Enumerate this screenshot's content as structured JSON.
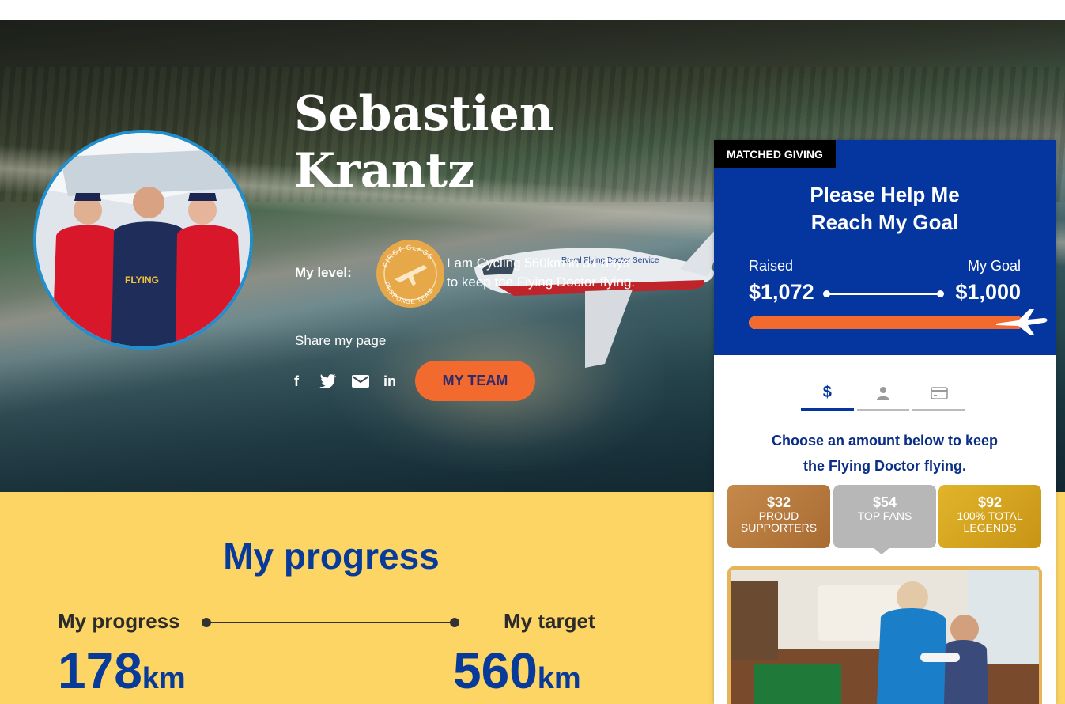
{
  "profile": {
    "first_name": "Sebastien",
    "last_name": "Krantz",
    "level_label": "My level:",
    "badge_text_top": "FIRST CLASS",
    "badge_text_bottom": "RESPONSE TEAM",
    "level_line1": "I am Cycling 560km in 31 days",
    "level_line2": "to keep the Flying Doctor flying.",
    "share_label": "Share my page",
    "team_button": "MY TEAM",
    "avatar_shirt_text": "FLYING"
  },
  "social": [
    {
      "icon": "facebook-icon",
      "glyph": "f"
    },
    {
      "icon": "twitter-icon",
      "glyph": "🐦"
    },
    {
      "icon": "email-icon",
      "glyph": "✉"
    },
    {
      "icon": "linkedin-icon",
      "glyph": "in"
    }
  ],
  "plane_livery": "Royal Flying Doctor Service",
  "progress": {
    "title": "My progress",
    "left_label": "My progress",
    "right_label": "My target",
    "current_value": "178",
    "target_value": "560",
    "unit": "km"
  },
  "donate": {
    "matched_tag": "MATCHED GIVING",
    "title_line1": "Please Help Me",
    "title_line2": "Reach My Goal",
    "raised_label": "Raised",
    "goal_label": "My Goal",
    "raised_value": "$1,072",
    "goal_value": "$1,000",
    "progress_fraction": 1.0,
    "tabs": [
      {
        "icon": "dollar-icon",
        "glyph": "$"
      },
      {
        "icon": "person-icon",
        "glyph": ""
      },
      {
        "icon": "card-icon",
        "glyph": ""
      }
    ],
    "choose_line1": "Choose an amount below to keep",
    "choose_line2": "the Flying Doctor flying.",
    "amounts": [
      {
        "value": "$32",
        "line1": "PROUD",
        "line2": "SUPPORTERS"
      },
      {
        "value": "$54",
        "line1": "TOP FANS",
        "line2": ""
      },
      {
        "value": "$92",
        "line1": "100% TOTAL",
        "line2": "LEGENDS"
      }
    ]
  },
  "colors": {
    "brand_blue": "#0536a0",
    "accent_orange": "#f26a2e",
    "progress_yellow": "#fcd565",
    "bronze": "#b87a3e",
    "silver": "#b7b7b8",
    "gold": "#d6a41f"
  }
}
